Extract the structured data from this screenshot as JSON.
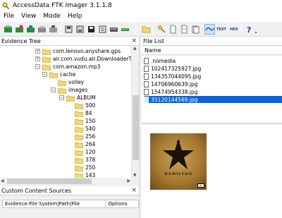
{
  "window": {
    "title": "AccessData FTK Imager 3.1.1.8"
  },
  "menu": [
    "File",
    "View",
    "Mode",
    "Help"
  ],
  "evidence_tree": {
    "title": "Evidence Tree",
    "close": "×",
    "items": [
      {
        "label": "com.lenovo.anyshare.gps",
        "level": 0,
        "expander": "+"
      },
      {
        "label": "air.com.vudu.air.DownloaderTablet",
        "level": 0,
        "expander": "+"
      },
      {
        "label": "com.amazon.mp3",
        "level": 0,
        "expander": "−"
      },
      {
        "label": "cache",
        "level": 1,
        "expander": "−"
      },
      {
        "label": "volley",
        "level": 2,
        "expander": ""
      },
      {
        "label": "images",
        "level": 2,
        "expander": "−"
      },
      {
        "label": "ALBUM",
        "level": 3,
        "expander": "−"
      },
      {
        "label": "500",
        "level": 4,
        "expander": ""
      },
      {
        "label": "84",
        "level": 4,
        "expander": ""
      },
      {
        "label": "150",
        "level": 4,
        "expander": ""
      },
      {
        "label": "540",
        "level": 4,
        "expander": ""
      },
      {
        "label": "256",
        "level": 4,
        "expander": ""
      },
      {
        "label": "264",
        "level": 4,
        "expander": ""
      },
      {
        "label": "120",
        "level": 4,
        "expander": ""
      },
      {
        "label": "378",
        "level": 4,
        "expander": ""
      },
      {
        "label": "250",
        "level": 4,
        "expander": ""
      },
      {
        "label": "143",
        "level": 4,
        "expander": ""
      }
    ]
  },
  "file_list": {
    "title": "File List",
    "column": "Name",
    "files": [
      {
        "name": ".nomedia",
        "selected": false
      },
      {
        "name": "102417325927.jpg",
        "selected": false
      },
      {
        "name": "134357044095.jpg",
        "selected": false
      },
      {
        "name": "14706960639.jpg",
        "selected": false
      },
      {
        "name": "15474954338.jpg",
        "selected": false
      },
      {
        "name": "35120144569.jpg",
        "selected": true
      }
    ]
  },
  "preview": {
    "title": "HAMILTON",
    "badge": "PA"
  },
  "custom_content": {
    "title": "Custom Content Sources",
    "close": "×",
    "columns": [
      "Evidence:File System|Path|File",
      "Options"
    ]
  },
  "colors": {
    "selection": "#0a64d6",
    "folder": "#f5d76e",
    "accent": "#1a3a8a"
  }
}
